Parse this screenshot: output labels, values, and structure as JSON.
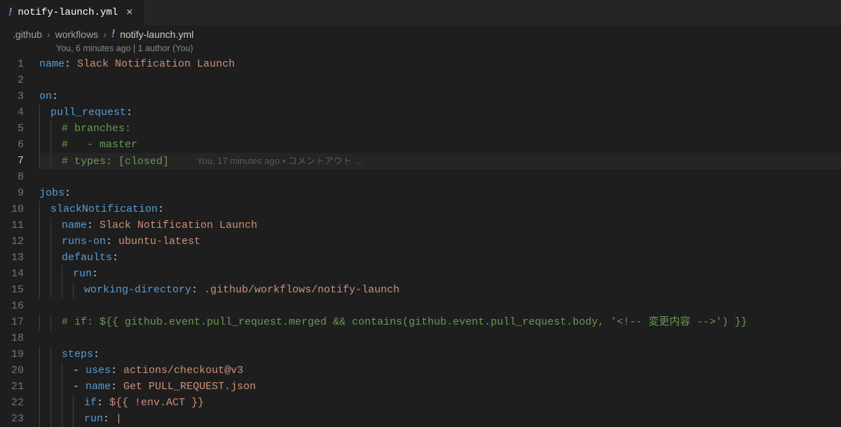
{
  "tab": {
    "icon": "!",
    "filename": "notify-launch.yml",
    "close": "×"
  },
  "breadcrumbs": {
    "parts": [
      ".github",
      "workflows"
    ],
    "sep": "›",
    "final_icon": "!",
    "final": "notify-launch.yml"
  },
  "codelens": "You, 6 minutes ago | 1 author (You)",
  "blame_line7": "You, 17 minutes ago • コメントアウト …",
  "lines": {
    "l1": {
      "n": "1",
      "k1": "name",
      "c": ":",
      "v": " Slack Notification Launch"
    },
    "l2": {
      "n": "2"
    },
    "l3": {
      "n": "3",
      "k1": "on",
      "c": ":"
    },
    "l4": {
      "n": "4",
      "k1": "pull_request",
      "c": ":"
    },
    "l5": {
      "n": "5",
      "cm": "# branches:"
    },
    "l6": {
      "n": "6",
      "cm": "#   - master"
    },
    "l7": {
      "n": "7",
      "cm": "# types: [closed]"
    },
    "l8": {
      "n": "8"
    },
    "l9": {
      "n": "9",
      "k1": "jobs",
      "c": ":"
    },
    "l10": {
      "n": "10",
      "k1": "slackNotification",
      "c": ":"
    },
    "l11": {
      "n": "11",
      "k1": "name",
      "c": ":",
      "v": " Slack Notification Launch"
    },
    "l12": {
      "n": "12",
      "k1": "runs-on",
      "c": ":",
      "v": " ubuntu-latest"
    },
    "l13": {
      "n": "13",
      "k1": "defaults",
      "c": ":"
    },
    "l14": {
      "n": "14",
      "k1": "run",
      "c": ":"
    },
    "l15": {
      "n": "15",
      "k1": "working-directory",
      "c": ":",
      "v": " .github/workflows/notify-launch"
    },
    "l16": {
      "n": "16"
    },
    "l17": {
      "n": "17",
      "cm": "# if: ${{ github.event.pull_request.merged && contains(github.event.pull_request.body, '<!-- 変更内容 -->') }}"
    },
    "l18": {
      "n": "18"
    },
    "l19": {
      "n": "19",
      "k1": "steps",
      "c": ":"
    },
    "l20": {
      "n": "20",
      "d": "- ",
      "k1": "uses",
      "c": ":",
      "v": " actions/checkout@v3"
    },
    "l21": {
      "n": "21",
      "d": "- ",
      "k1": "name",
      "c": ":",
      "v": " Get PULL_REQUEST.json"
    },
    "l22": {
      "n": "22",
      "k1": "if",
      "c": ":",
      "v": " ${{ !env.ACT }}"
    },
    "l23": {
      "n": "23",
      "k1": "run",
      "c": ":",
      "v": " |"
    }
  }
}
